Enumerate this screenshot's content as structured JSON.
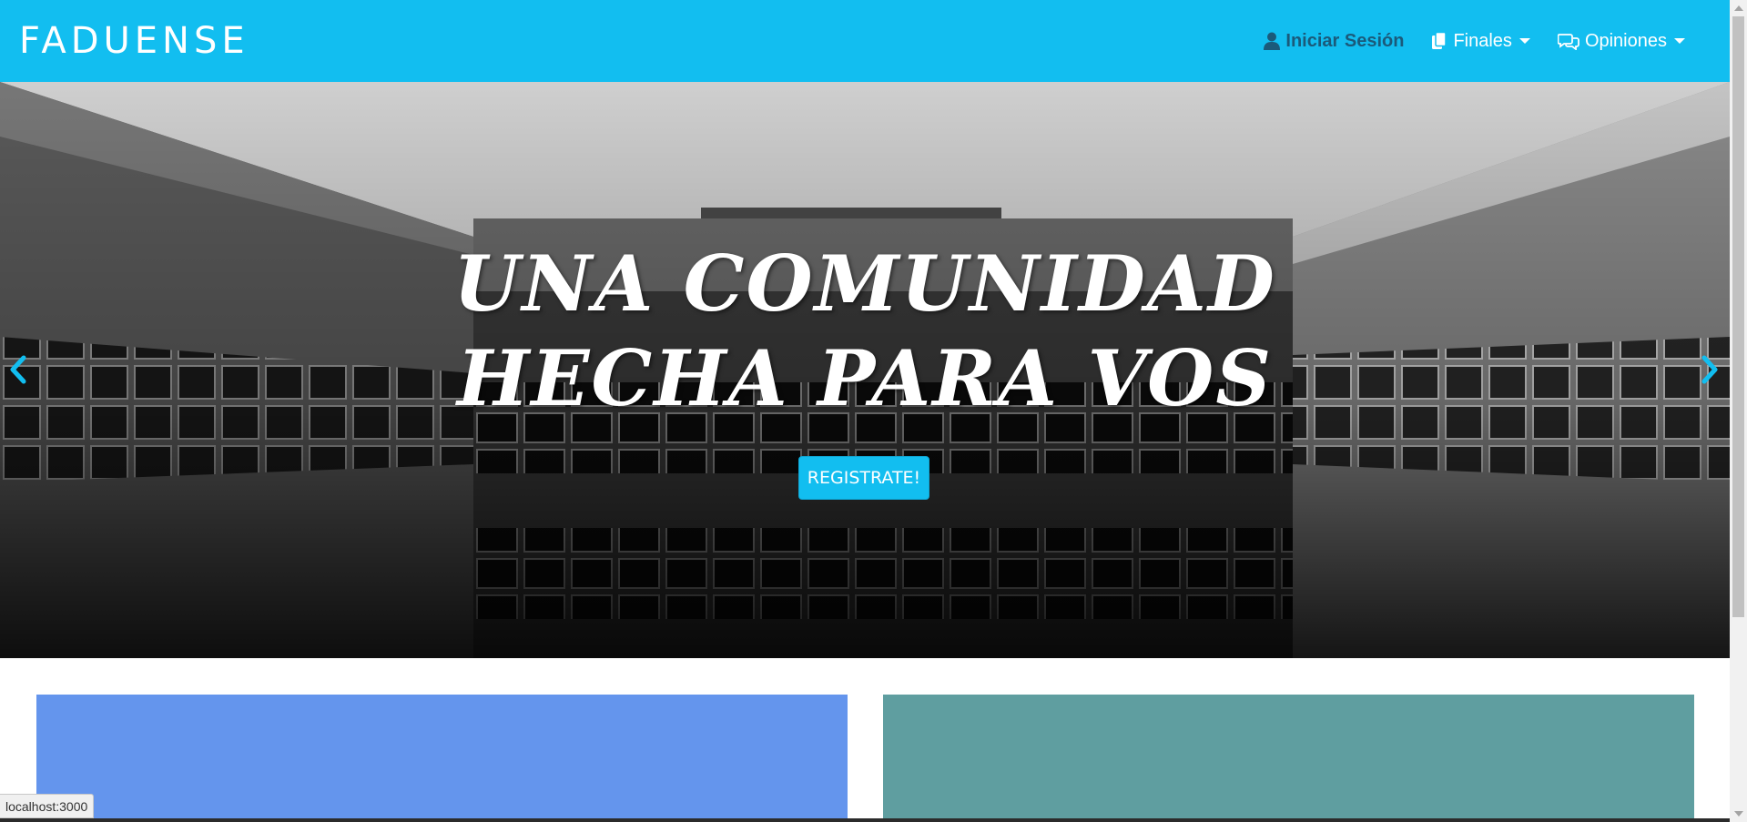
{
  "navbar": {
    "brand": "FADUENSE",
    "login_label": "Iniciar Sesión",
    "finales_label": "Finales",
    "opiniones_label": "Opiniones"
  },
  "hero": {
    "title": "Una comunidad hecha para vos",
    "cta_label": "REGISTRATE!",
    "prev_icon": "chevron-left-icon",
    "next_icon": "chevron-right-icon"
  },
  "cards": {
    "left_color": "#6495ed",
    "right_color": "#5f9ea0"
  },
  "status_bar": {
    "url": "localhost:3000"
  },
  "colors": {
    "accent": "#12bef0",
    "login_text": "#1b5a7a"
  }
}
